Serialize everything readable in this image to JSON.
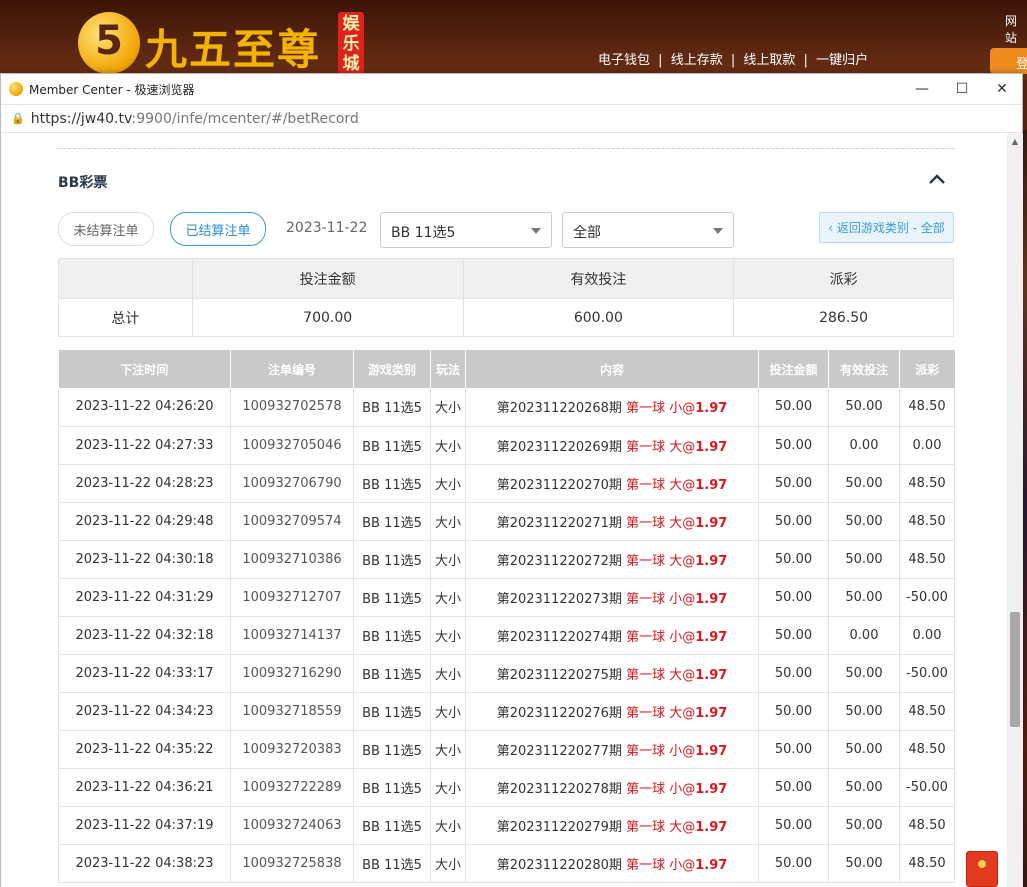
{
  "site": {
    "logo_digit": "5",
    "logo_text": "九五至尊",
    "logo_badge": "娱乐城",
    "top_links": [
      "电子钱包",
      "|",
      "线上存款",
      "|",
      "线上取款",
      "|",
      "一键归户"
    ],
    "top_right_text": "网站",
    "login_label": "登"
  },
  "browser": {
    "title": "Member Center - 极速浏览器",
    "url_main": "https://jw40.tv",
    "url_rest": ":9900/infe/mcenter/#/betRecord",
    "minimize": "—",
    "maximize": "☐",
    "close": "✕"
  },
  "section": {
    "title": "BB彩票",
    "collapse_icon": "chevron-up-icon"
  },
  "filters": {
    "unsettled_label": "未结算注单",
    "settled_label": "已结算注单",
    "date": "2023-11-22",
    "game_select": "BB 11选5",
    "type_select": "全部",
    "back_label": "‹ 返回游戏类别 - 全部"
  },
  "summary": {
    "headers": [
      "",
      "投注金额",
      "有效投注",
      "派彩"
    ],
    "row_label": "总计",
    "bet_amount": "700.00",
    "valid_bet": "600.00",
    "payout": "286.50"
  },
  "records": {
    "headers": [
      "下注时间",
      "注单编号",
      "游戏类别",
      "玩法",
      "内容",
      "投注金额",
      "有效投注",
      "派彩"
    ],
    "rows": [
      {
        "time": "2023-11-22 04:26:20",
        "no": "100932702578",
        "game": "BB 11选5",
        "play": "大小",
        "period": "第202311220268期",
        "pick": "第一球 小@",
        "odds": "1.97",
        "bet": "50.00",
        "valid": "50.00",
        "payout": "48.50"
      },
      {
        "time": "2023-11-22 04:27:33",
        "no": "100932705046",
        "game": "BB 11选5",
        "play": "大小",
        "period": "第202311220269期",
        "pick": "第一球 大@",
        "odds": "1.97",
        "bet": "50.00",
        "valid": "0.00",
        "payout": "0.00"
      },
      {
        "time": "2023-11-22 04:28:23",
        "no": "100932706790",
        "game": "BB 11选5",
        "play": "大小",
        "period": "第202311220270期",
        "pick": "第一球 大@",
        "odds": "1.97",
        "bet": "50.00",
        "valid": "50.00",
        "payout": "48.50"
      },
      {
        "time": "2023-11-22 04:29:48",
        "no": "100932709574",
        "game": "BB 11选5",
        "play": "大小",
        "period": "第202311220271期",
        "pick": "第一球 大@",
        "odds": "1.97",
        "bet": "50.00",
        "valid": "50.00",
        "payout": "48.50"
      },
      {
        "time": "2023-11-22 04:30:18",
        "no": "100932710386",
        "game": "BB 11选5",
        "play": "大小",
        "period": "第202311220272期",
        "pick": "第一球 大@",
        "odds": "1.97",
        "bet": "50.00",
        "valid": "50.00",
        "payout": "48.50"
      },
      {
        "time": "2023-11-22 04:31:29",
        "no": "100932712707",
        "game": "BB 11选5",
        "play": "大小",
        "period": "第202311220273期",
        "pick": "第一球 小@",
        "odds": "1.97",
        "bet": "50.00",
        "valid": "50.00",
        "payout": "-50.00"
      },
      {
        "time": "2023-11-22 04:32:18",
        "no": "100932714137",
        "game": "BB 11选5",
        "play": "大小",
        "period": "第202311220274期",
        "pick": "第一球 小@",
        "odds": "1.97",
        "bet": "50.00",
        "valid": "0.00",
        "payout": "0.00"
      },
      {
        "time": "2023-11-22 04:33:17",
        "no": "100932716290",
        "game": "BB 11选5",
        "play": "大小",
        "period": "第202311220275期",
        "pick": "第一球 大@",
        "odds": "1.97",
        "bet": "50.00",
        "valid": "50.00",
        "payout": "-50.00"
      },
      {
        "time": "2023-11-22 04:34:23",
        "no": "100932718559",
        "game": "BB 11选5",
        "play": "大小",
        "period": "第202311220276期",
        "pick": "第一球 大@",
        "odds": "1.97",
        "bet": "50.00",
        "valid": "50.00",
        "payout": "48.50"
      },
      {
        "time": "2023-11-22 04:35:22",
        "no": "100932720383",
        "game": "BB 11选5",
        "play": "大小",
        "period": "第202311220277期",
        "pick": "第一球 小@",
        "odds": "1.97",
        "bet": "50.00",
        "valid": "50.00",
        "payout": "48.50"
      },
      {
        "time": "2023-11-22 04:36:21",
        "no": "100932722289",
        "game": "BB 11选5",
        "play": "大小",
        "period": "第202311220278期",
        "pick": "第一球 小@",
        "odds": "1.97",
        "bet": "50.00",
        "valid": "50.00",
        "payout": "-50.00"
      },
      {
        "time": "2023-11-22 04:37:19",
        "no": "100932724063",
        "game": "BB 11选5",
        "play": "大小",
        "period": "第202311220279期",
        "pick": "第一球 大@",
        "odds": "1.97",
        "bet": "50.00",
        "valid": "50.00",
        "payout": "48.50"
      },
      {
        "time": "2023-11-22 04:38:23",
        "no": "100932725838",
        "game": "BB 11选5",
        "play": "大小",
        "period": "第202311220280期",
        "pick": "第一球 小@",
        "odds": "1.97",
        "bet": "50.00",
        "valid": "50.00",
        "payout": "48.50"
      }
    ]
  },
  "colors": {
    "accent_blue": "#2a8fd8",
    "pick_red": "#d9181f",
    "negative_red": "#e0333a",
    "header_gray": "#c9c9c9"
  }
}
